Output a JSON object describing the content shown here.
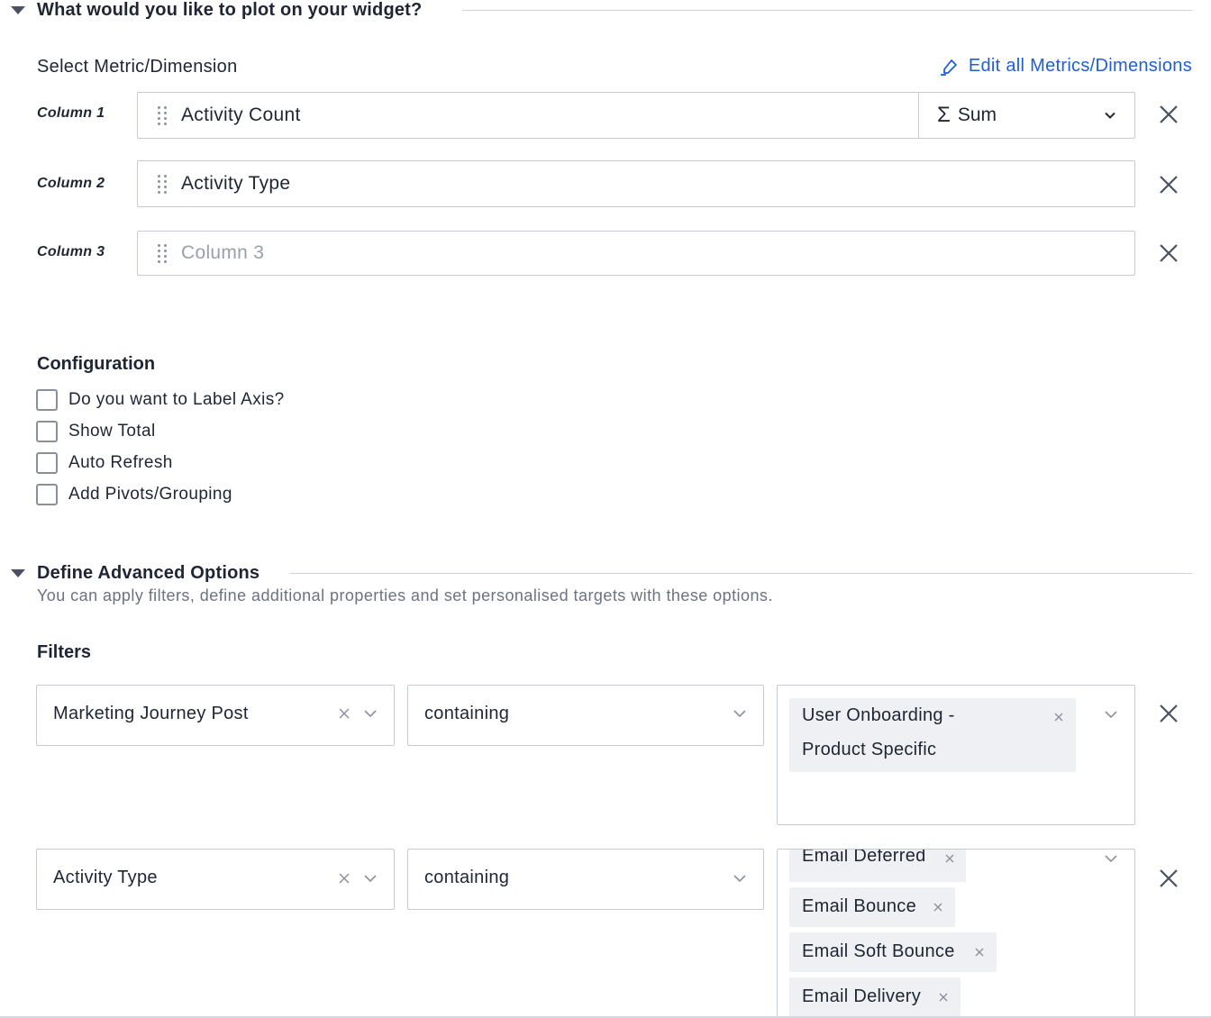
{
  "plot_section": {
    "title": "What would you like to plot on your widget?",
    "select_label": "Select Metric/Dimension",
    "edit_link": "Edit all Metrics/Dimensions",
    "columns": [
      {
        "label": "Column 1",
        "value": "Activity Count",
        "aggregation": "Sum",
        "aggregation_symbol": "Σ"
      },
      {
        "label": "Column 2",
        "value": "Activity Type"
      },
      {
        "label": "Column 3",
        "placeholder": "Column 3"
      }
    ]
  },
  "configuration": {
    "title": "Configuration",
    "options": [
      {
        "label": "Do you want to Label Axis?",
        "checked": false
      },
      {
        "label": "Show Total",
        "checked": false
      },
      {
        "label": "Auto Refresh",
        "checked": false
      },
      {
        "label": "Add Pivots/Grouping",
        "checked": false
      }
    ]
  },
  "advanced": {
    "title": "Define Advanced Options",
    "subtitle": "You can apply filters, define additional properties and set personalised targets with these options.",
    "filters_title": "Filters",
    "filters": [
      {
        "field": "Marketing Journey Post",
        "operator": "containing",
        "values": [
          "User Onboarding - Product Specific"
        ],
        "value_lines": [
          "User Onboarding -",
          "Product Specific"
        ]
      },
      {
        "field": "Activity Type",
        "operator": "containing",
        "values": [
          "Email Deferred",
          "Email Bounce",
          "Email Soft Bounce",
          "Email Delivery"
        ]
      }
    ]
  },
  "colors": {
    "link": "#1f5fd6",
    "border": "#c6cbd3",
    "chip_bg": "#eef0f3",
    "text": "#1e2533",
    "muted": "#6b7280"
  }
}
